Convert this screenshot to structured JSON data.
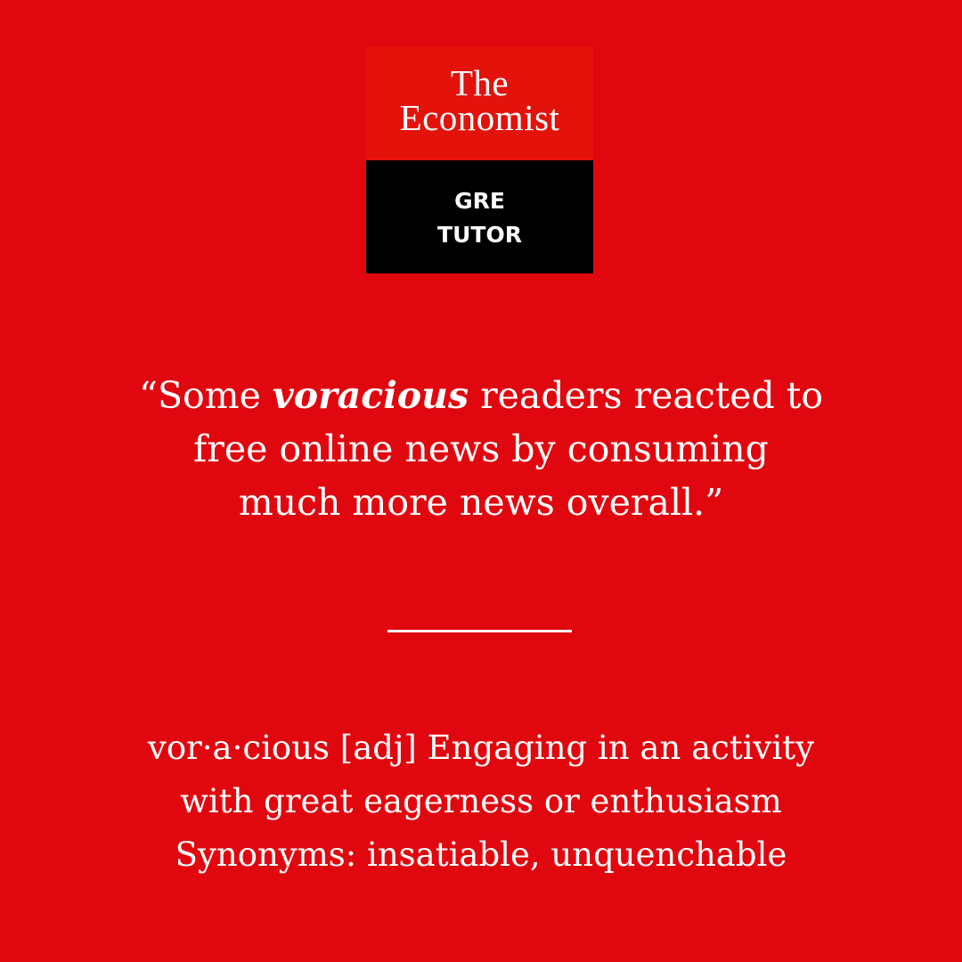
{
  "logo": {
    "wordmark_line1": "The",
    "wordmark_line2": "Economist",
    "sub_line1": "GRE",
    "sub_line2": "TUTOR"
  },
  "quote": {
    "open_mark": "“",
    "line1_before": "Some ",
    "highlight_word": "voracious",
    "line1_after": " readers reacted to",
    "line2": "free online news by consuming",
    "line3": "much more news overall.”"
  },
  "definition": {
    "line1": "vor·a·cious [adj] Engaging in an activity",
    "line2": "with great eagerness or enthusiasm",
    "line3": "Synonyms: insatiable, unquenchable"
  },
  "colors": {
    "background": "#e1070f",
    "logo_red": "#e3120b",
    "logo_black": "#000000",
    "text": "#ffffff"
  }
}
